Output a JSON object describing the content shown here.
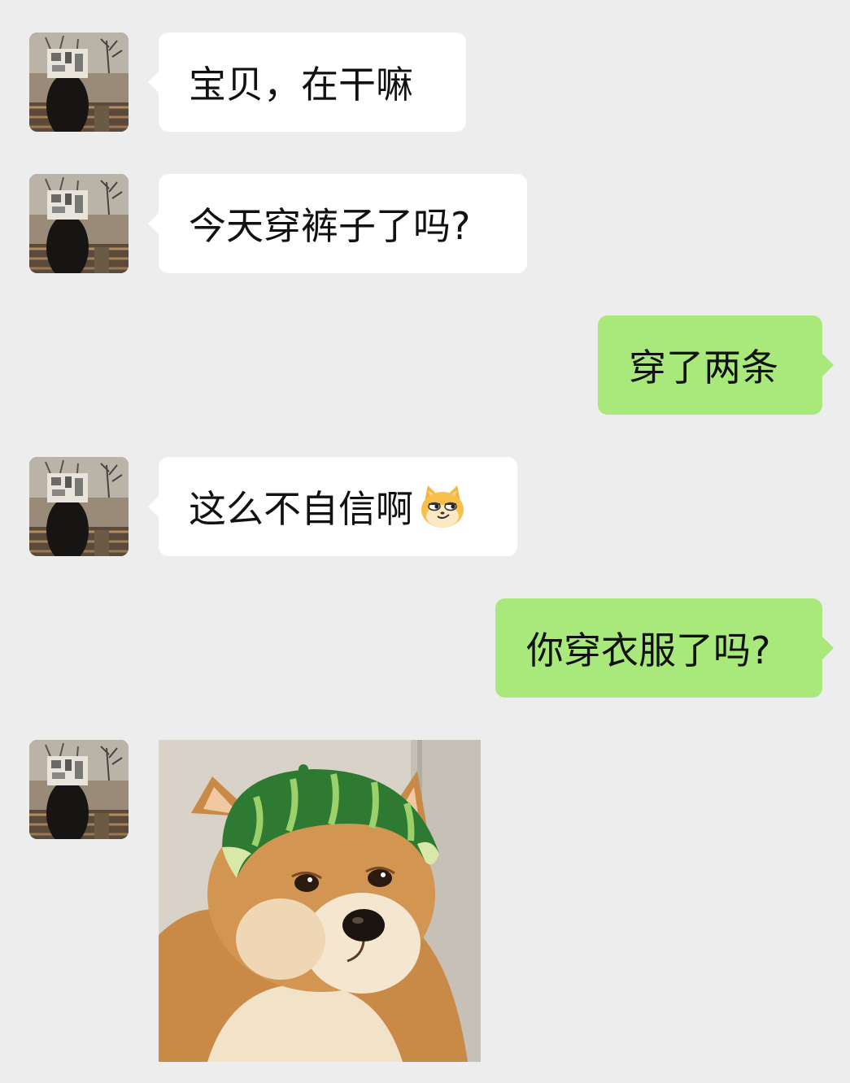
{
  "chat": {
    "messages": [
      {
        "from": "contact",
        "text": "宝贝，在干嘛"
      },
      {
        "from": "contact",
        "text": "今天穿裤子了吗?"
      },
      {
        "from": "me",
        "text": "穿了两条"
      },
      {
        "from": "contact",
        "text": "这么不自信啊",
        "emoji": "smirking-cat-emoji"
      },
      {
        "from": "me",
        "text": "你穿衣服了吗?"
      },
      {
        "from": "contact",
        "sticker": "shiba-dog-watermelon-hat-sticker"
      }
    ]
  },
  "colors": {
    "background": "#ededed",
    "incoming_bubble": "#ffffff",
    "outgoing_bubble": "#a9e97b"
  }
}
